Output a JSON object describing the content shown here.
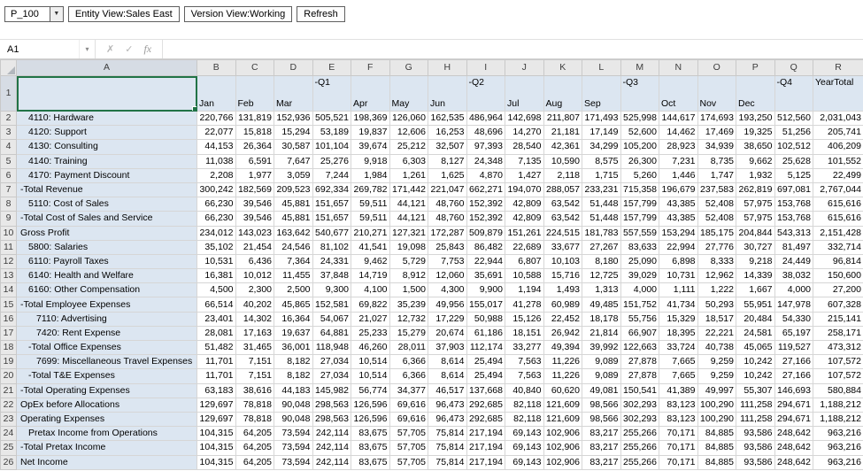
{
  "toolbar": {
    "pov_member": "P_100",
    "dropdown_icon": "▼",
    "entity_button": "Entity View:Sales East",
    "version_button": "Version View:Working",
    "refresh_button": "Refresh"
  },
  "formula_bar": {
    "name_box": "A1",
    "cancel_icon": "✗",
    "enter_icon": "✓",
    "function_icon": "fx",
    "formula_value": ""
  },
  "colors": {
    "member_fill": "#dce6f1",
    "selection": "#217346",
    "grid_line": "#d6d6d6",
    "header_fill": "#e8e8e8"
  },
  "grid": {
    "selected_cell": "A1",
    "column_letters": [
      "A",
      "B",
      "C",
      "D",
      "E",
      "F",
      "G",
      "H",
      "I",
      "J",
      "K",
      "L",
      "M",
      "N",
      "O",
      "P",
      "Q",
      "R"
    ],
    "header_row": {
      "number": "1",
      "cells": [
        {
          "col": "B",
          "label": "Jan",
          "valign": "bottom"
        },
        {
          "col": "C",
          "label": "Feb",
          "valign": "bottom"
        },
        {
          "col": "D",
          "label": "Mar",
          "valign": "bottom"
        },
        {
          "col": "E",
          "label": "-Q1",
          "valign": "top"
        },
        {
          "col": "F",
          "label": "Apr",
          "valign": "bottom"
        },
        {
          "col": "G",
          "label": "May",
          "valign": "bottom"
        },
        {
          "col": "H",
          "label": "Jun",
          "valign": "bottom"
        },
        {
          "col": "I",
          "label": "-Q2",
          "valign": "top"
        },
        {
          "col": "J",
          "label": "Jul",
          "valign": "bottom"
        },
        {
          "col": "K",
          "label": "Aug",
          "valign": "bottom"
        },
        {
          "col": "L",
          "label": "Sep",
          "valign": "bottom"
        },
        {
          "col": "M",
          "label": "-Q3",
          "valign": "top"
        },
        {
          "col": "N",
          "label": "Oct",
          "valign": "bottom"
        },
        {
          "col": "O",
          "label": "Nov",
          "valign": "bottom"
        },
        {
          "col": "P",
          "label": "Dec",
          "valign": "bottom"
        },
        {
          "col": "Q",
          "label": "-Q4",
          "valign": "top"
        },
        {
          "col": "R",
          "label": "YearTotal",
          "valign": "top"
        }
      ]
    },
    "rows": [
      {
        "number": "2",
        "label": "4110: Hardware",
        "indent": 1,
        "values": [
          "220,766",
          "131,819",
          "152,936",
          "505,521",
          "198,369",
          "126,060",
          "162,535",
          "486,964",
          "142,698",
          "211,807",
          "171,493",
          "525,998",
          "144,617",
          "174,693",
          "193,250",
          "512,560",
          "2,031,043"
        ]
      },
      {
        "number": "3",
        "label": "4120: Support",
        "indent": 1,
        "values": [
          "22,077",
          "15,818",
          "15,294",
          "53,189",
          "19,837",
          "12,606",
          "16,253",
          "48,696",
          "14,270",
          "21,181",
          "17,149",
          "52,600",
          "14,462",
          "17,469",
          "19,325",
          "51,256",
          "205,741"
        ]
      },
      {
        "number": "4",
        "label": "4130: Consulting",
        "indent": 1,
        "values": [
          "44,153",
          "26,364",
          "30,587",
          "101,104",
          "39,674",
          "25,212",
          "32,507",
          "97,393",
          "28,540",
          "42,361",
          "34,299",
          "105,200",
          "28,923",
          "34,939",
          "38,650",
          "102,512",
          "406,209"
        ]
      },
      {
        "number": "5",
        "label": "4140: Training",
        "indent": 1,
        "values": [
          "11,038",
          "6,591",
          "7,647",
          "25,276",
          "9,918",
          "6,303",
          "8,127",
          "24,348",
          "7,135",
          "10,590",
          "8,575",
          "26,300",
          "7,231",
          "8,735",
          "9,662",
          "25,628",
          "101,552"
        ]
      },
      {
        "number": "6",
        "label": "4170: Payment Discount",
        "indent": 1,
        "values": [
          "2,208",
          "1,977",
          "3,059",
          "7,244",
          "1,984",
          "1,261",
          "1,625",
          "4,870",
          "1,427",
          "2,118",
          "1,715",
          "5,260",
          "1,446",
          "1,747",
          "1,932",
          "5,125",
          "22,499"
        ]
      },
      {
        "number": "7",
        "label": "-Total Revenue",
        "indent": 0,
        "values": [
          "300,242",
          "182,569",
          "209,523",
          "692,334",
          "269,782",
          "171,442",
          "221,047",
          "662,271",
          "194,070",
          "288,057",
          "233,231",
          "715,358",
          "196,679",
          "237,583",
          "262,819",
          "697,081",
          "2,767,044"
        ]
      },
      {
        "number": "8",
        "label": "5110: Cost of Sales",
        "indent": 1,
        "values": [
          "66,230",
          "39,546",
          "45,881",
          "151,657",
          "59,511",
          "44,121",
          "48,760",
          "152,392",
          "42,809",
          "63,542",
          "51,448",
          "157,799",
          "43,385",
          "52,408",
          "57,975",
          "153,768",
          "615,616"
        ]
      },
      {
        "number": "9",
        "label": "-Total Cost of Sales and Service",
        "indent": 0,
        "values": [
          "66,230",
          "39,546",
          "45,881",
          "151,657",
          "59,511",
          "44,121",
          "48,760",
          "152,392",
          "42,809",
          "63,542",
          "51,448",
          "157,799",
          "43,385",
          "52,408",
          "57,975",
          "153,768",
          "615,616"
        ]
      },
      {
        "number": "10",
        "label": "Gross Profit",
        "indent": 0,
        "values": [
          "234,012",
          "143,023",
          "163,642",
          "540,677",
          "210,271",
          "127,321",
          "172,287",
          "509,879",
          "151,261",
          "224,515",
          "181,783",
          "557,559",
          "153,294",
          "185,175",
          "204,844",
          "543,313",
          "2,151,428"
        ]
      },
      {
        "number": "11",
        "label": "5800: Salaries",
        "indent": 1,
        "values": [
          "35,102",
          "21,454",
          "24,546",
          "81,102",
          "41,541",
          "19,098",
          "25,843",
          "86,482",
          "22,689",
          "33,677",
          "27,267",
          "83,633",
          "22,994",
          "27,776",
          "30,727",
          "81,497",
          "332,714"
        ]
      },
      {
        "number": "12",
        "label": "6110: Payroll Taxes",
        "indent": 1,
        "values": [
          "10,531",
          "6,436",
          "7,364",
          "24,331",
          "9,462",
          "5,729",
          "7,753",
          "22,944",
          "6,807",
          "10,103",
          "8,180",
          "25,090",
          "6,898",
          "8,333",
          "9,218",
          "24,449",
          "96,814"
        ]
      },
      {
        "number": "13",
        "label": "6140: Health and Welfare",
        "indent": 1,
        "values": [
          "16,381",
          "10,012",
          "11,455",
          "37,848",
          "14,719",
          "8,912",
          "12,060",
          "35,691",
          "10,588",
          "15,716",
          "12,725",
          "39,029",
          "10,731",
          "12,962",
          "14,339",
          "38,032",
          "150,600"
        ]
      },
      {
        "number": "14",
        "label": "6160: Other Compensation",
        "indent": 1,
        "values": [
          "4,500",
          "2,300",
          "2,500",
          "9,300",
          "4,100",
          "1,500",
          "4,300",
          "9,900",
          "1,194",
          "1,493",
          "1,313",
          "4,000",
          "1,111",
          "1,222",
          "1,667",
          "4,000",
          "27,200"
        ]
      },
      {
        "number": "15",
        "label": "-Total Employee Expenses",
        "indent": 0,
        "values": [
          "66,514",
          "40,202",
          "45,865",
          "152,581",
          "69,822",
          "35,239",
          "49,956",
          "155,017",
          "41,278",
          "60,989",
          "49,485",
          "151,752",
          "41,734",
          "50,293",
          "55,951",
          "147,978",
          "607,328"
        ]
      },
      {
        "number": "16",
        "label": "7110: Advertising",
        "indent": 2,
        "values": [
          "23,401",
          "14,302",
          "16,364",
          "54,067",
          "21,027",
          "12,732",
          "17,229",
          "50,988",
          "15,126",
          "22,452",
          "18,178",
          "55,756",
          "15,329",
          "18,517",
          "20,484",
          "54,330",
          "215,141"
        ]
      },
      {
        "number": "17",
        "label": "7420: Rent Expense",
        "indent": 2,
        "values": [
          "28,081",
          "17,163",
          "19,637",
          "64,881",
          "25,233",
          "15,279",
          "20,674",
          "61,186",
          "18,151",
          "26,942",
          "21,814",
          "66,907",
          "18,395",
          "22,221",
          "24,581",
          "65,197",
          "258,171"
        ]
      },
      {
        "number": "18",
        "label": "-Total Office Expenses",
        "indent": 1,
        "values": [
          "51,482",
          "31,465",
          "36,001",
          "118,948",
          "46,260",
          "28,011",
          "37,903",
          "112,174",
          "33,277",
          "49,394",
          "39,992",
          "122,663",
          "33,724",
          "40,738",
          "45,065",
          "119,527",
          "473,312"
        ]
      },
      {
        "number": "19",
        "label": "7699: Miscellaneous Travel Expenses",
        "indent": 2,
        "values": [
          "11,701",
          "7,151",
          "8,182",
          "27,034",
          "10,514",
          "6,366",
          "8,614",
          "25,494",
          "7,563",
          "11,226",
          "9,089",
          "27,878",
          "7,665",
          "9,259",
          "10,242",
          "27,166",
          "107,572"
        ]
      },
      {
        "number": "20",
        "label": "-Total T&E Expenses",
        "indent": 1,
        "values": [
          "11,701",
          "7,151",
          "8,182",
          "27,034",
          "10,514",
          "6,366",
          "8,614",
          "25,494",
          "7,563",
          "11,226",
          "9,089",
          "27,878",
          "7,665",
          "9,259",
          "10,242",
          "27,166",
          "107,572"
        ]
      },
      {
        "number": "21",
        "label": "-Total Operating Expenses",
        "indent": 0,
        "values": [
          "63,183",
          "38,616",
          "44,183",
          "145,982",
          "56,774",
          "34,377",
          "46,517",
          "137,668",
          "40,840",
          "60,620",
          "49,081",
          "150,541",
          "41,389",
          "49,997",
          "55,307",
          "146,693",
          "580,884"
        ]
      },
      {
        "number": "22",
        "label": "OpEx before Allocations",
        "indent": 0,
        "values": [
          "129,697",
          "78,818",
          "90,048",
          "298,563",
          "126,596",
          "69,616",
          "96,473",
          "292,685",
          "82,118",
          "121,609",
          "98,566",
          "302,293",
          "83,123",
          "100,290",
          "111,258",
          "294,671",
          "1,188,212"
        ]
      },
      {
        "number": "23",
        "label": "Operating Expenses",
        "indent": 0,
        "values": [
          "129,697",
          "78,818",
          "90,048",
          "298,563",
          "126,596",
          "69,616",
          "96,473",
          "292,685",
          "82,118",
          "121,609",
          "98,566",
          "302,293",
          "83,123",
          "100,290",
          "111,258",
          "294,671",
          "1,188,212"
        ]
      },
      {
        "number": "24",
        "label": "Pretax Income from Operations",
        "indent": 1,
        "values": [
          "104,315",
          "64,205",
          "73,594",
          "242,114",
          "83,675",
          "57,705",
          "75,814",
          "217,194",
          "69,143",
          "102,906",
          "83,217",
          "255,266",
          "70,171",
          "84,885",
          "93,586",
          "248,642",
          "963,216"
        ]
      },
      {
        "number": "25",
        "label": "-Total Pretax Income",
        "indent": 0,
        "values": [
          "104,315",
          "64,205",
          "73,594",
          "242,114",
          "83,675",
          "57,705",
          "75,814",
          "217,194",
          "69,143",
          "102,906",
          "83,217",
          "255,266",
          "70,171",
          "84,885",
          "93,586",
          "248,642",
          "963,216"
        ]
      },
      {
        "number": "26",
        "label": "Net Income",
        "indent": 0,
        "values": [
          "104,315",
          "64,205",
          "73,594",
          "242,114",
          "83,675",
          "57,705",
          "75,814",
          "217,194",
          "69,143",
          "102,906",
          "83,217",
          "255,266",
          "70,171",
          "84,885",
          "93,586",
          "248,642",
          "963,216"
        ]
      }
    ]
  }
}
